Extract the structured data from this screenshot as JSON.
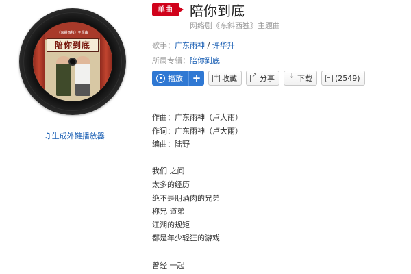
{
  "album": {
    "cover_title": "陪你到底",
    "cover_small": "《东斜西独》主题曲",
    "gen_link_label": "生成外链播放器"
  },
  "song": {
    "badge": "单曲",
    "title": "陪你到底",
    "subtitle": "网络剧《东斜西独》主题曲"
  },
  "meta": {
    "singer_label": "歌手：",
    "singers": [
      "广东雨神",
      "许华升"
    ],
    "singer_sep": " / ",
    "album_label": "所属专辑：",
    "album_name": "陪你到底"
  },
  "actions": {
    "play": "播放",
    "plus": "+",
    "favorite": "收藏",
    "share": "分享",
    "download": "下载",
    "comments": "(2549)"
  },
  "lyrics": [
    "作曲：广东雨神（卢大雨）",
    "作词：广东雨神（卢大雨）",
    "编曲：陆野",
    "",
    "我们 之间",
    "太多的经历",
    "绝不是朋酒肉的兄弟",
    "称兄 道弟",
    "江湖的规矩",
    "都是年少轻狂的游戏",
    "",
    "曾经 一起"
  ],
  "colors": {
    "badge": "#d0021b",
    "link": "#1a5fb4",
    "play_button": "#2f78d3"
  }
}
